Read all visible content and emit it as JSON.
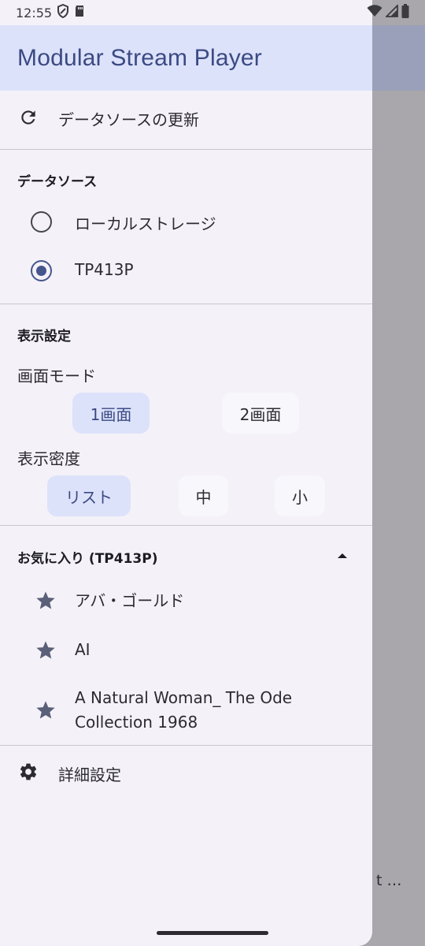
{
  "status_bar": {
    "time": "12:55"
  },
  "background_app": {
    "peek_text": "t …"
  },
  "drawer": {
    "title": "Modular Stream Player",
    "refresh_label": "データソースの更新",
    "data_source": {
      "section_title": "データソース",
      "options": [
        {
          "label": "ローカルストレージ",
          "selected": false
        },
        {
          "label": "TP413P",
          "selected": true
        }
      ]
    },
    "display_settings": {
      "section_title": "表示設定",
      "screen_mode_label": "画面モード",
      "screen_mode_options": [
        "1画面",
        "2画面"
      ],
      "screen_mode_selected": "1画面",
      "density_label": "表示密度",
      "density_options": [
        "リスト",
        "中",
        "小"
      ],
      "density_selected": "リスト"
    },
    "favorites": {
      "section_title": "お気に入り (TP413P)",
      "items": [
        {
          "line1": "アバ・ゴールド",
          "line2": ""
        },
        {
          "line1": "AI",
          "line2": ""
        },
        {
          "line1": "A Natural Woman_ The Ode",
          "line2": "Collection 1968"
        }
      ]
    },
    "advanced_label": "詳細設定"
  },
  "colors": {
    "accent": "#45558e",
    "header_bg": "#dde2fb",
    "drawer_bg": "#f4f2f8",
    "scrim": "#a9a7ab"
  }
}
